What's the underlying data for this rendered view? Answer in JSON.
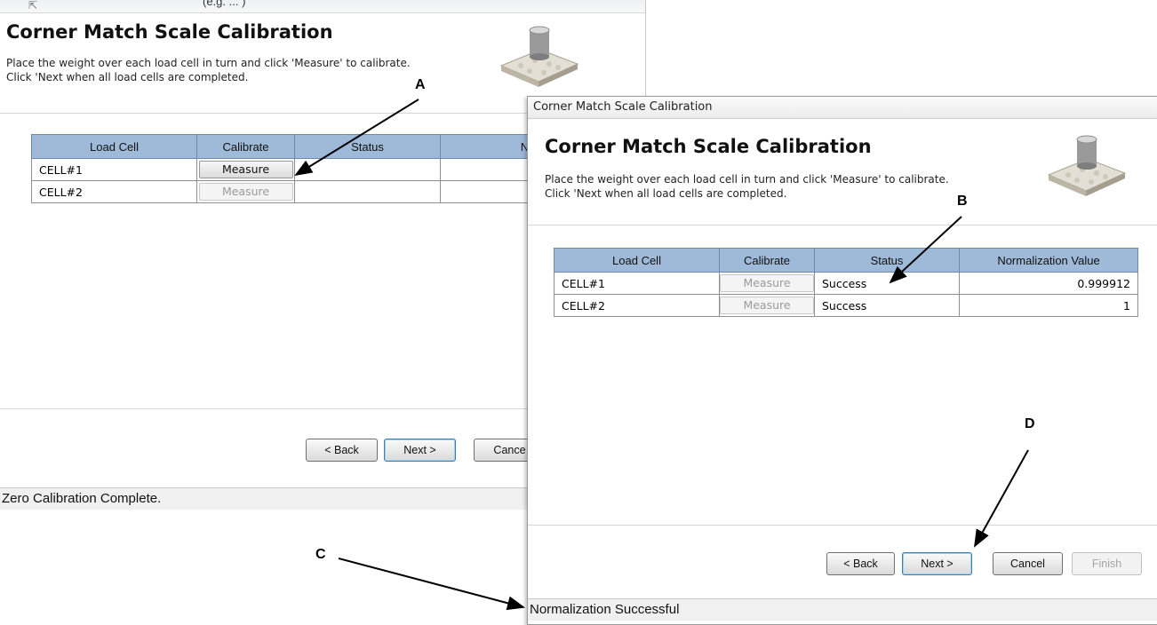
{
  "window_back": {
    "top_text": "(e.g. ... )",
    "title": "Corner Match Scale Calibration",
    "instruction_1": "Place the weight over each load cell in turn and click 'Measure' to calibrate.",
    "instruction_2": "Click 'Next when all load cells are completed.",
    "columns": [
      "Load Cell",
      "Calibrate",
      "Status",
      "Normalize"
    ],
    "rows": [
      {
        "cell": "CELL#1",
        "calibrate": "Measure",
        "status": "",
        "value": ""
      },
      {
        "cell": "CELL#2",
        "calibrate": "Measure",
        "status": "",
        "value": ""
      }
    ],
    "buttons": {
      "back": "< Back",
      "next": "Next >",
      "cancel": "Cance"
    },
    "status_bar": "Zero Calibration Complete."
  },
  "window_front": {
    "titlebar": "Corner Match Scale Calibration",
    "title": "Corner Match Scale Calibration",
    "instruction_1": "Place the weight over each load cell in turn and click 'Measure' to calibrate.",
    "instruction_2": "Click 'Next when all load cells are completed.",
    "columns": [
      "Load Cell",
      "Calibrate",
      "Status",
      "Normalization Value"
    ],
    "rows": [
      {
        "cell": "CELL#1",
        "calibrate": "Measure",
        "status": "Success",
        "value": "0.999912"
      },
      {
        "cell": "CELL#2",
        "calibrate": "Measure",
        "status": "Success",
        "value": "1"
      }
    ],
    "buttons": {
      "back": "< Back",
      "next": "Next >",
      "cancel": "Cancel",
      "finish": "Finish"
    },
    "status_bar": "Normalization Successful"
  },
  "callouts": {
    "a": "A",
    "b": "B",
    "c": "C",
    "d": "D"
  },
  "colors": {
    "header_blue": "#9fb9d8",
    "body_gray": "#f0f0f0"
  }
}
